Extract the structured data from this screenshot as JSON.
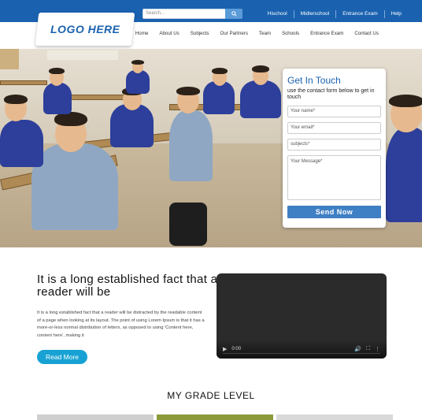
{
  "topbar": {
    "search_placeholder": "Search...",
    "links": [
      "Hischool",
      "Midlerschool",
      "Entrance Exam",
      "Help"
    ]
  },
  "logo": {
    "text": "LOGO HERE"
  },
  "nav": {
    "items": [
      "Home",
      "About Us",
      "Subjects",
      "Our Partners",
      "Team",
      "Schools",
      "Entrance Exam",
      "Contact Us"
    ]
  },
  "contact_form": {
    "title": "Get In Touch",
    "subtitle": "use the contact form below to get in touch",
    "name_placeholder": "Your name*",
    "email_placeholder": "Your email*",
    "subject_placeholder": "subjects*",
    "message_placeholder": "Your Message*",
    "send_label": "Send Now"
  },
  "intro": {
    "heading": "It is a long established fact that a reader will be",
    "body": "It is a long established fact that a reader will be distracted by the readable content of a page when looking at its layout. The point of using Lorem Ipsum is that it has a more-or-less normal distribution of letters, as opposed to using 'Content here, content here', making it",
    "button": "Read More"
  },
  "video": {
    "time": "0:00"
  },
  "grade": {
    "heading": "MY GRADE LEVEL"
  },
  "colors": {
    "brand_blue": "#1a62b0",
    "button_cyan": "#17a2d3",
    "send_blue": "#3f7fc4"
  }
}
